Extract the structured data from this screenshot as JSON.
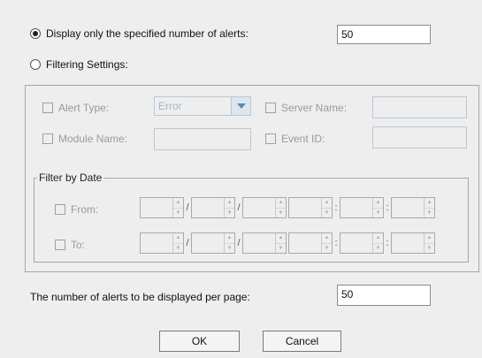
{
  "options": {
    "display_limit_label": "Display only the specified number of alerts:",
    "display_limit_value": "50",
    "filtering_label": "Filtering Settings:"
  },
  "filter": {
    "alert_type_label": "Alert Type:",
    "alert_type_value": "Error",
    "server_name_label": "Server Name:",
    "module_name_label": "Module Name:",
    "event_id_label": "Event ID:"
  },
  "date": {
    "legend": "Filter by Date",
    "from_label": "From:",
    "to_label": "To:",
    "sep_slash": "/",
    "sep_colon": ":"
  },
  "paging": {
    "per_page_label": "The number of alerts to be displayed per page:",
    "per_page_value": "50"
  },
  "buttons": {
    "ok": "OK",
    "cancel": "Cancel"
  },
  "spinner_arrows": {
    "up": "▲",
    "down": "▼"
  }
}
